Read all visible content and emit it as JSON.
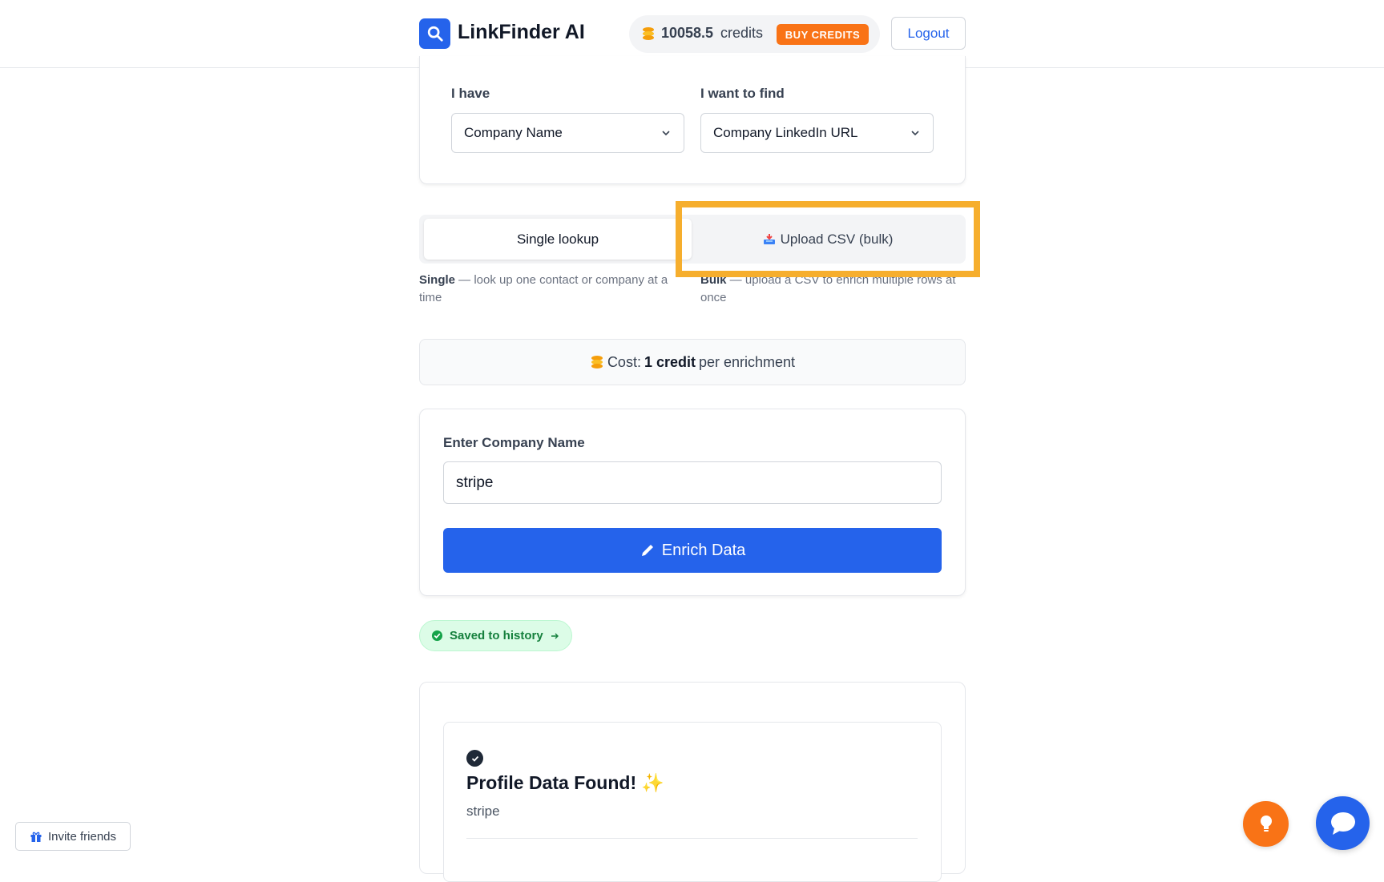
{
  "header": {
    "app_name": "LinkFinder AI",
    "credits_value": "10058.5",
    "credits_label": "credits",
    "buy_credits_label": "BUY CREDITS",
    "logout_label": "Logout"
  },
  "selectors": {
    "have_label": "I have",
    "have_value": "Company Name",
    "find_label": "I want to find",
    "find_value": "Company LinkedIn URL"
  },
  "mode_tabs": {
    "single_label": "Single lookup",
    "bulk_label": "Upload CSV (bulk)",
    "single_title": "Single",
    "single_desc": " — look up one contact or company at a time",
    "bulk_title": "Bulk",
    "bulk_desc": " — upload a CSV to enrich multiple rows at once"
  },
  "cost": {
    "prefix": "Cost:",
    "amount": "1 credit",
    "suffix": "per enrichment"
  },
  "form": {
    "input_label": "Enter Company Name",
    "input_value": "stripe",
    "enrich_label": "Enrich Data"
  },
  "saved": {
    "label": "Saved to history"
  },
  "result": {
    "title": "Profile Data Found!",
    "sparkle": "✨",
    "subtitle": "stripe"
  },
  "footer": {
    "invite_label": "Invite friends"
  },
  "colors": {
    "primary": "#2563eb",
    "accent_orange": "#f97316",
    "success_green": "#15803d",
    "highlight": "#f6ae2d"
  }
}
